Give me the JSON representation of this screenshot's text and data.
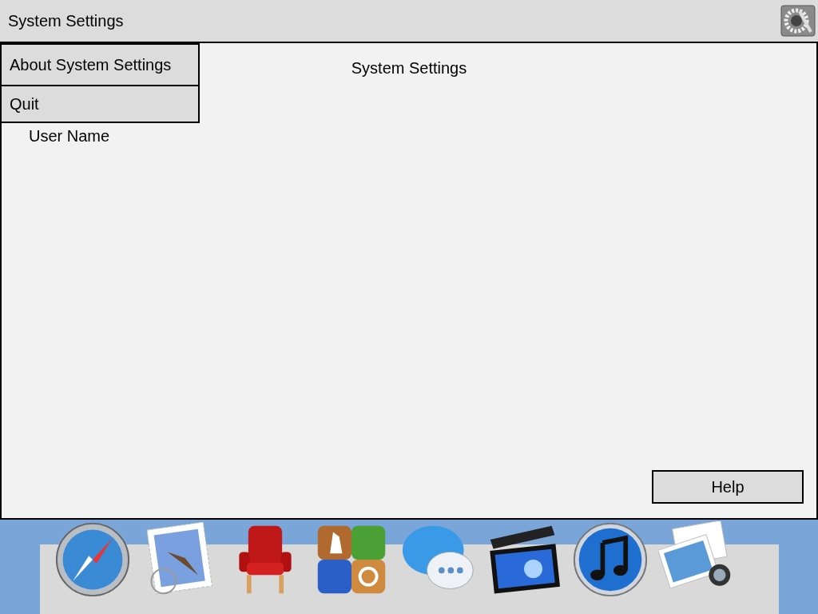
{
  "title_bar": {
    "title": "System Settings"
  },
  "menu": {
    "items": [
      {
        "label": "About System Settings"
      },
      {
        "label": "Quit"
      }
    ]
  },
  "window": {
    "title": "System Settings",
    "user_name": "User Name"
  },
  "buttons": [
    {
      "label": "Help"
    }
  ]
}
